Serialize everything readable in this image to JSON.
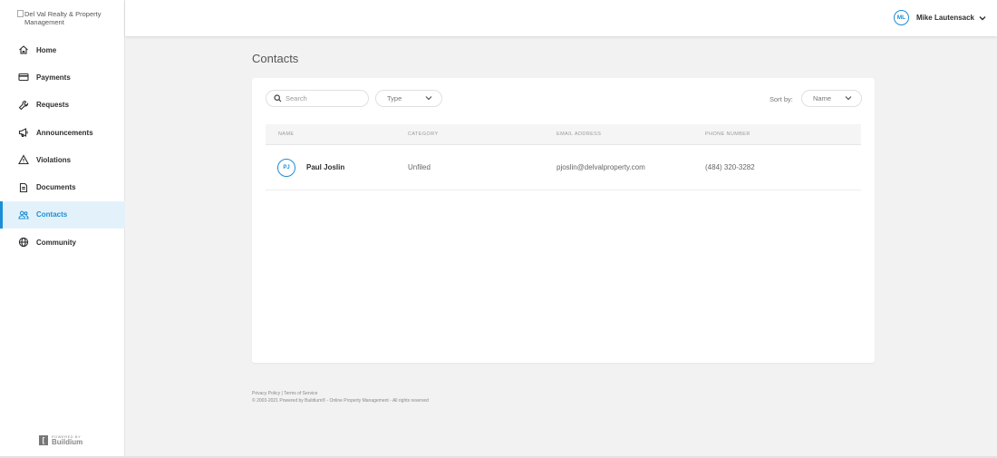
{
  "app": {
    "logo_alt": "Del Val Realty & Property Management"
  },
  "sidebar": {
    "items": [
      {
        "label": "Home",
        "icon": "home-icon"
      },
      {
        "label": "Payments",
        "icon": "credit-card-icon"
      },
      {
        "label": "Requests",
        "icon": "wrench-icon"
      },
      {
        "label": "Announcements",
        "icon": "megaphone-icon"
      },
      {
        "label": "Violations",
        "icon": "warning-icon"
      },
      {
        "label": "Documents",
        "icon": "document-icon"
      },
      {
        "label": "Contacts",
        "icon": "contacts-icon",
        "active": true
      },
      {
        "label": "Community",
        "icon": "globe-icon"
      }
    ],
    "powered_by_small": "POWERED BY",
    "powered_by_brand": "Buildium"
  },
  "topbar": {
    "user_initials": "ML",
    "user_name": "Mike Lautensack"
  },
  "main": {
    "page_title": "Contacts",
    "search_placeholder": "Search",
    "type_select": "Type",
    "sort_label": "Sort by:",
    "sort_value": "Name",
    "columns": [
      "NAME",
      "CATEGORY",
      "EMAIL ADDRESS",
      "PHONE NUMBER"
    ],
    "rows": [
      {
        "initials": "PJ",
        "name": "Paul Joslin",
        "category": "Unfiled",
        "email": "pjoslin@delvalproperty.com",
        "phone": "(484) 320-3282"
      }
    ]
  },
  "footer": {
    "privacy": "Privacy Policy",
    "separator": " | ",
    "terms": "Terms of Service",
    "copyright": "© 2003-2021 Powered by Buildium® - Online Property Management - All rights reserved"
  },
  "colors": {
    "accent": "#1c8ed6",
    "active_bg": "#e3f2fa",
    "page_bg": "#f2f2f2"
  }
}
